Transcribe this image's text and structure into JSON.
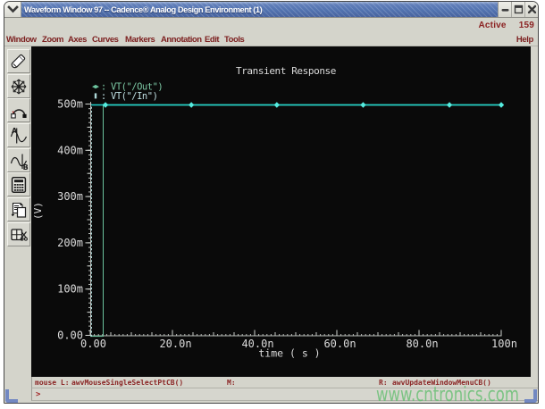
{
  "window": {
    "title": "Waveform Window 97 -- Cadence® Analog Design Environment (1)",
    "active_label": "Active",
    "active_count": "159"
  },
  "menu": {
    "items": [
      "Window",
      "Zoom",
      "Axes",
      "Curves",
      "Markers",
      "Annotation",
      "Edit",
      "Tools"
    ],
    "help": "Help"
  },
  "toolbar": {
    "buttons": [
      {
        "icon": "probe-pen-icon"
      },
      {
        "icon": "zoom-fit-starburst-icon"
      },
      {
        "icon": "trace-arc-icon"
      },
      {
        "icon": "marker-a-icon"
      },
      {
        "icon": "marker-b-icon"
      },
      {
        "icon": "calculator-icon"
      },
      {
        "icon": "copy-strip-icon"
      },
      {
        "icon": "split-window-icon"
      }
    ]
  },
  "statusbar": {
    "mouse_label": "mouse L:",
    "left_binding": "awvMouseSingleSelectPtCB()",
    "middle_label": "M:",
    "right_label": "R:",
    "right_binding": "awvUpdateWindowMenuCB()"
  },
  "prompt": ">",
  "watermark": "www.cntronics.com",
  "colors": {
    "titlebar_blue": "#5273b0",
    "menu_text_red": "#7c1f1f",
    "status_text_red": "#8b2525",
    "out_trace_green": "#6cc39e",
    "in_trace_cyan": "#1fd3cc",
    "in_marker_cyan": "#55ecdf",
    "in_rise_pale": "#aed8d8",
    "axis_gray": "#b9bdb9",
    "plot_text": "#dcdcdc",
    "watermark_green": "#64be70",
    "corner_blue": "#7288c2"
  },
  "chart_data": {
    "type": "line",
    "title": "Transient Response",
    "xlabel": "time ( s )",
    "ylabel": "(V)",
    "x_unit": "ns",
    "xlim": [
      0,
      100
    ],
    "ylim": [
      0,
      0.5
    ],
    "grid": false,
    "legend_position": "top-left",
    "x_ticks": [
      {
        "label": "0.00",
        "value": 0
      },
      {
        "label": "20.0n",
        "value": 20
      },
      {
        "label": "40.0n",
        "value": 40
      },
      {
        "label": "60.0n",
        "value": 60
      },
      {
        "label": "80.0n",
        "value": 80
      },
      {
        "label": "100n",
        "value": 100
      }
    ],
    "y_ticks": [
      {
        "label": "0.00",
        "value": 0
      },
      {
        "label": "100m",
        "value": 0.1
      },
      {
        "label": "200m",
        "value": 0.2
      },
      {
        "label": "300m",
        "value": 0.3
      },
      {
        "label": "400m",
        "value": 0.4
      },
      {
        "label": "500m",
        "value": 0.5
      }
    ],
    "x_minor_step": 1,
    "x_sub_step": 5,
    "y_minor_step": 0.01,
    "y_sub_step": 0.05,
    "series": [
      {
        "name": "VT(\"/Out\")",
        "legend_glyph": "hdiamond",
        "flat_color": "#6cc39e",
        "rise_color": "#6cc39e",
        "text_color": "#7cc8a4",
        "dashed": false,
        "marker": "none",
        "points": [
          [
            0,
            0
          ],
          [
            3.0,
            0
          ],
          [
            3.05,
            0.5
          ],
          [
            100,
            0.5
          ]
        ]
      },
      {
        "name": "VT(\"/In\")",
        "legend_glyph": "vbar",
        "flat_color": "#1fd3cc",
        "rise_color": "#aed8d8",
        "text_color": "#bfdfe2",
        "dashed": true,
        "marker": "diamond",
        "marker_color": "#55ecdf",
        "marker_x": [
          3.7,
          24.6,
          45.4,
          66.4,
          87.4,
          100
        ],
        "points": [
          [
            0,
            0
          ],
          [
            0.2,
            0
          ],
          [
            0.25,
            0.5
          ],
          [
            100,
            0.5
          ]
        ]
      }
    ]
  }
}
